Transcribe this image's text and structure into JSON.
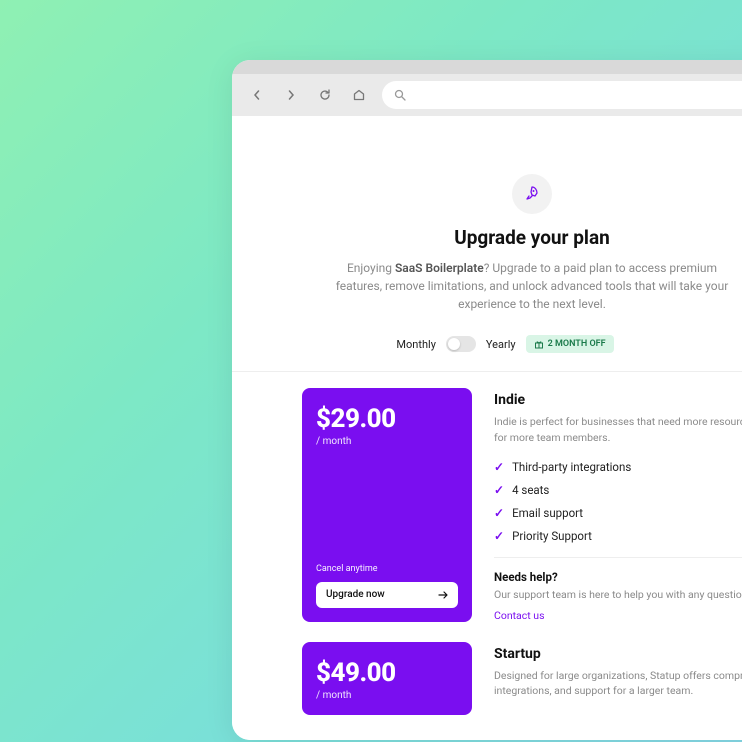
{
  "header": {
    "title": "Upgrade your plan",
    "subtitle_prefix": "Enjoying ",
    "subtitle_brand": "SaaS Boilerplate",
    "subtitle_suffix": "? Upgrade to a paid plan to access premium features, remove limitations, and unlock advanced tools that will take your experience to the next level."
  },
  "billing": {
    "monthly_label": "Monthly",
    "yearly_label": "Yearly",
    "promo": "2 MONTH OFF"
  },
  "plans": [
    {
      "price": "$29.00",
      "period": "/ month",
      "cancel_note": "Cancel anytime",
      "cta": "Upgrade now",
      "name": "Indie",
      "description": "Indie is perfect for businesses that need more resources, and capacity for more team members.",
      "features": [
        "Third-party integrations",
        "4 seats",
        "Email support",
        "Priority Support"
      ]
    },
    {
      "price": "$49.00",
      "period": "/ month",
      "name": "Startup",
      "description": "Designed for large organizations, Statup offers comprehensive integrations, and support for a larger team."
    }
  ],
  "help": {
    "title": "Needs help?",
    "text": "Our support team is here to help you with any questions o",
    "link": "Contact us"
  },
  "colors": {
    "accent": "#7a0ef0",
    "promo_bg": "#d9f5e6",
    "promo_fg": "#1a7a4a"
  }
}
